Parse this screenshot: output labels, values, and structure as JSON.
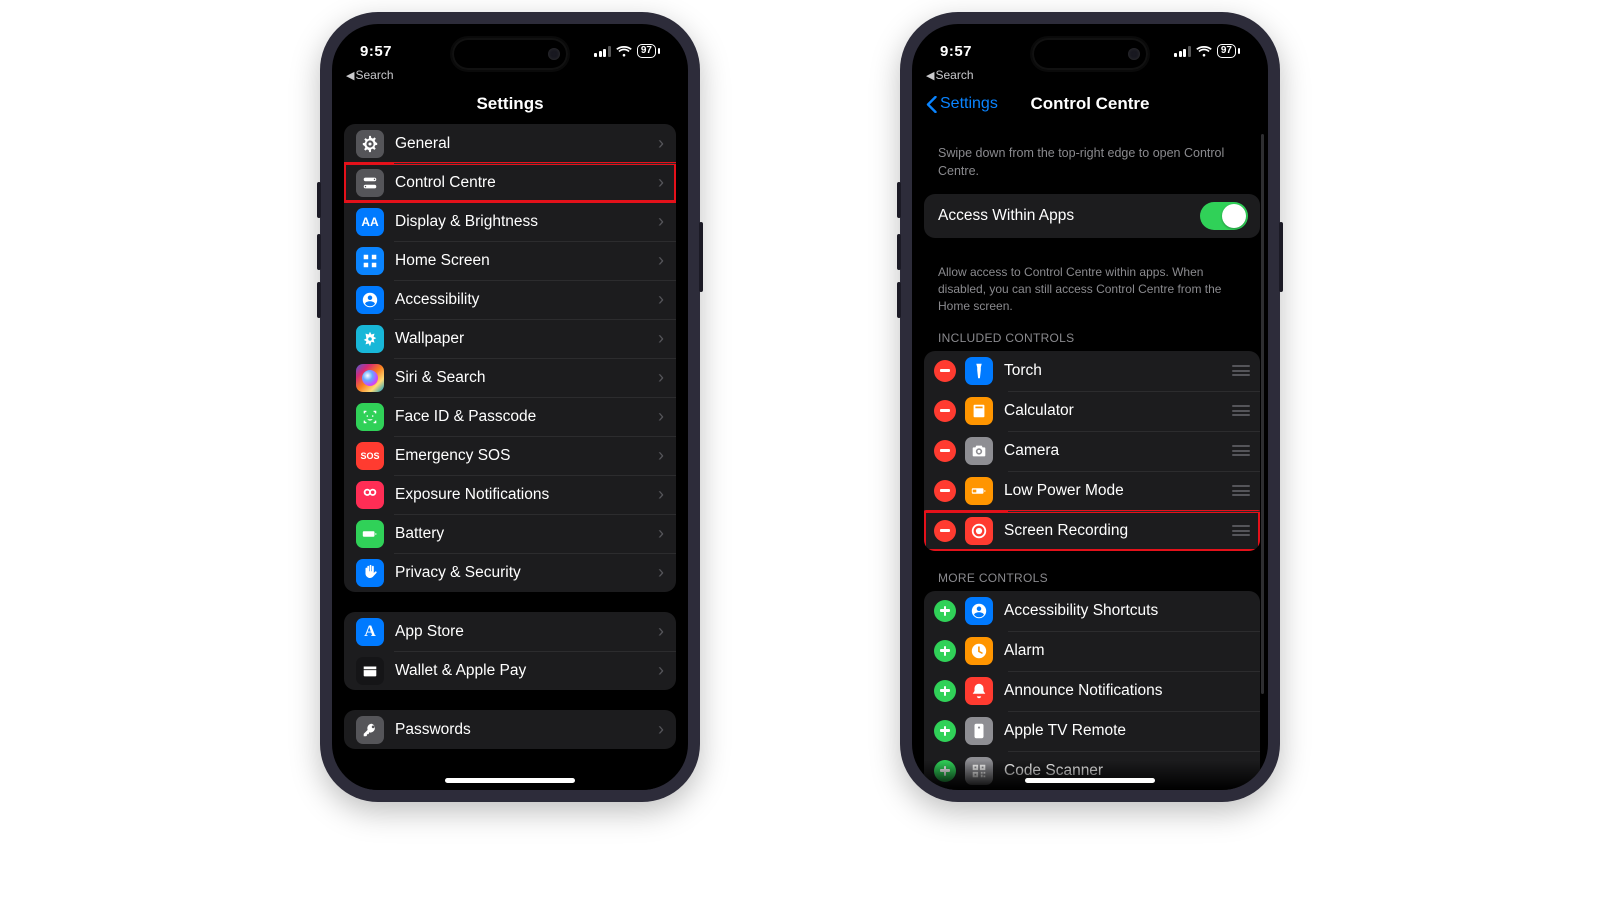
{
  "status": {
    "time": "9:57",
    "battery": "97",
    "breadcrumb": "Search"
  },
  "screen1": {
    "title": "Settings",
    "groups": [
      [
        {
          "id": "general",
          "label": "General",
          "bg": "bg-gray",
          "glyph": "gear"
        },
        {
          "id": "cc",
          "label": "Control Centre",
          "bg": "bg-gray",
          "glyph": "switches",
          "highlight": true
        },
        {
          "id": "display",
          "label": "Display & Brightness",
          "bg": "bg-blue",
          "glyph": "AA"
        },
        {
          "id": "home",
          "label": "Home Screen",
          "bg": "bg-bluel",
          "glyph": "grid"
        },
        {
          "id": "access",
          "label": "Accessibility",
          "bg": "bg-blue",
          "glyph": "person"
        },
        {
          "id": "wall",
          "label": "Wallpaper",
          "bg": "bg-cyan",
          "glyph": "flower"
        },
        {
          "id": "siri",
          "label": "Siri & Search",
          "bg": "bg-siri",
          "glyph": "siri"
        },
        {
          "id": "faceid",
          "label": "Face ID & Passcode",
          "bg": "bg-green",
          "glyph": "faceid"
        },
        {
          "id": "sos",
          "label": "Emergency SOS",
          "bg": "bg-red",
          "glyph": "SOS"
        },
        {
          "id": "expose",
          "label": "Exposure Notifications",
          "bg": "bg-pink",
          "glyph": "expose"
        },
        {
          "id": "battery",
          "label": "Battery",
          "bg": "bg-green",
          "glyph": "batt"
        },
        {
          "id": "privacy",
          "label": "Privacy & Security",
          "bg": "bg-blue",
          "glyph": "hand"
        }
      ],
      [
        {
          "id": "appstore",
          "label": "App Store",
          "bg": "bg-blue",
          "glyph": "A"
        },
        {
          "id": "wallet",
          "label": "Wallet & Apple Pay",
          "bg": "bg-black",
          "glyph": "wallet"
        }
      ],
      [
        {
          "id": "passwords",
          "label": "Passwords",
          "bg": "bg-gray",
          "glyph": "key"
        }
      ]
    ]
  },
  "screen2": {
    "back": "Settings",
    "title": "Control Centre",
    "intro": "Swipe down from the top-right edge to open Control Centre.",
    "access": {
      "label": "Access Within Apps",
      "on": true,
      "caption": "Allow access to Control Centre within apps. When disabled, you can still access Control Centre from the Home screen."
    },
    "included_header": "Included Controls",
    "included": [
      {
        "id": "torch",
        "label": "Torch",
        "bg": "bg-blue",
        "glyph": "torch"
      },
      {
        "id": "calc",
        "label": "Calculator",
        "bg": "bg-orange",
        "glyph": "calc"
      },
      {
        "id": "camera",
        "label": "Camera",
        "bg": "bg-grayL",
        "glyph": "camera"
      },
      {
        "id": "lpm",
        "label": "Low Power Mode",
        "bg": "bg-orange",
        "glyph": "battlow"
      },
      {
        "id": "screc",
        "label": "Screen Recording",
        "bg": "bg-red",
        "glyph": "record",
        "highlight": true
      }
    ],
    "more_header": "More Controls",
    "more": [
      {
        "id": "accsc",
        "label": "Accessibility Shortcuts",
        "bg": "bg-blue",
        "glyph": "person"
      },
      {
        "id": "alarm",
        "label": "Alarm",
        "bg": "bg-orange",
        "glyph": "clock"
      },
      {
        "id": "announce",
        "label": "Announce Notifications",
        "bg": "bg-red",
        "glyph": "bell"
      },
      {
        "id": "atvr",
        "label": "Apple TV Remote",
        "bg": "bg-grayL",
        "glyph": "remote"
      },
      {
        "id": "codesc",
        "label": "Code Scanner",
        "bg": "bg-grayL",
        "glyph": "qr"
      }
    ]
  }
}
